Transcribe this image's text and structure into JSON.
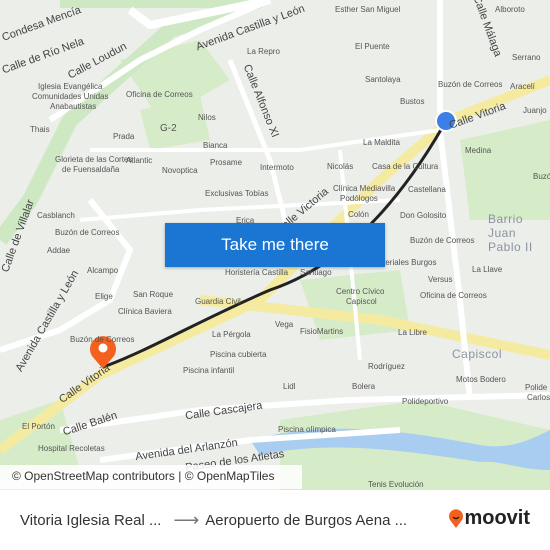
{
  "map": {
    "streets": [
      "Avenida Castilla y León",
      "Calle Loudun",
      "Calle Alfonso XI",
      "Calle Vitoria",
      "Calle Málaga",
      "Calle Cascajera",
      "Calle Balén",
      "Avenida del Arlanzón",
      "Paseo de los Atletas",
      "Calle Vitoria",
      "Calle de Río Nela",
      "Condesa Mencía",
      "Avenida Castilla y León",
      "Calle de Villalar",
      "Calle Victoria"
    ],
    "places": [
      "Esther San Miguel",
      "Alboroto",
      "El Puente",
      "La Repro",
      "Serrano",
      "Santolaya",
      "Buzón de Correos",
      "Aracelí",
      "Juanjo",
      "Iglesia Evangélica",
      "Comunidades Unidas",
      "Anabautistas",
      "Oficina de Correos",
      "Thais",
      "Prada",
      "Nilos",
      "G-2",
      "Bustos",
      "La Maldita",
      "Medina",
      "Bianca",
      "Prosame",
      "Intermoto",
      "Nicolás",
      "Casa de la Cultura",
      "Atlantic",
      "Novoptica",
      "Glorieta de las Cortes",
      "de Fuensaldaña",
      "Exclusivas Tobías",
      "Clínica Mediavilla",
      "Podólogos",
      "Castellana",
      "Colón",
      "Don Golosito",
      "Casblanch",
      "Buzón de Correos",
      "Erica",
      "Buzón de Correos",
      "Addae",
      "Alcampo",
      "Horistería Castilla",
      "Santiago",
      "Materiales Burgos",
      "La Llave",
      "Versus",
      "Elige",
      "San Roque",
      "Clínica Baviera",
      "Centro Cívico",
      "Capiscol",
      "Oficina de Correos",
      "Guardia Civil",
      "Vega",
      "FisioMartins",
      "La Libre",
      "Buzón de Correos",
      "La Pérgola",
      "Piscina cubierta",
      "Rodríguez",
      "Piscina infantil",
      "Lidl",
      "Bolera",
      "Motos Bodero",
      "Polideportivo",
      "El Portón",
      "Hospital Recoletas",
      "Piscina olímpica",
      "Tenis Evolución",
      "Buzón",
      "Polide",
      "Carlos"
    ],
    "areas": [
      "Barrio Juan Pablo II",
      "Capiscol"
    ],
    "attribution": "© OpenStreetMap contributors | © OpenMapTiles",
    "cta_label": "Take me there",
    "route_color": "#222222",
    "origin_color": "#3d7fe6",
    "destination_color": "#f4601e"
  },
  "footer": {
    "origin": "Vitoria Iglesia Real ...",
    "destination": "Aeropuerto de Burgos Aena ...",
    "brand": "moovit",
    "brand_color": "#f4601e"
  }
}
